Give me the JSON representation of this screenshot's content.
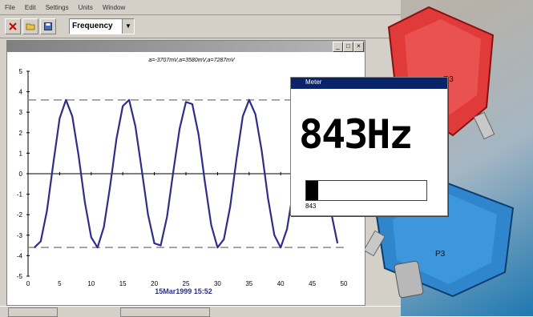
{
  "menu": {
    "items": [
      "File",
      "Edit",
      "Settings",
      "Units",
      "Window"
    ]
  },
  "toolbar": {
    "mode_value": "Frequency"
  },
  "scope": {
    "annotation": "a=-3707mV,a=3580mV,a=7287mV",
    "timestamp": "15Mar1999 15:52"
  },
  "meter": {
    "title": "Meter",
    "reading": "843Hz",
    "bar_level": 0.1,
    "sub_label": "843"
  },
  "devices": {
    "red_label": "R3",
    "blue_label": "P3"
  },
  "colors": {
    "trace": "#2e2d8c",
    "meter_title": "#0a246a",
    "red_device": "#e03a3a",
    "blue_device": "#2f86cc"
  },
  "icons": [
    "close-icon",
    "folder-icon",
    "save-icon",
    "maximize-icon",
    "restore-icon"
  ],
  "chart_data": {
    "type": "line",
    "x_ticks": [
      "0",
      "5",
      "10",
      "15",
      "20",
      "25",
      "30",
      "35",
      "40",
      "45",
      "50"
    ],
    "y_ticks": [
      "5",
      "4",
      "3",
      "2",
      "1",
      "0",
      "-1",
      "-2",
      "-3",
      "-4",
      "-5"
    ],
    "xlim": [
      0,
      50
    ],
    "ylim": [
      -5,
      5
    ],
    "series": [
      {
        "x": [
          1,
          2,
          3,
          4,
          5,
          6,
          7,
          8,
          9,
          10,
          11,
          12,
          13,
          14,
          15,
          16,
          17,
          18,
          19,
          20,
          21,
          22,
          23,
          24,
          25,
          26,
          27,
          28,
          29,
          30,
          31,
          32,
          33,
          34,
          35,
          36,
          37,
          38,
          39,
          40,
          41,
          42,
          43,
          44,
          45,
          46,
          47,
          48,
          49
        ],
        "y": [
          -3.6,
          -3.3,
          -1.8,
          0.5,
          2.7,
          3.6,
          2.8,
          0.9,
          -1.4,
          -3.1,
          -3.6,
          -2.6,
          -0.6,
          1.7,
          3.3,
          3.6,
          2.3,
          0.2,
          -2.0,
          -3.4,
          -3.5,
          -2.1,
          0.1,
          2.2,
          3.5,
          3.4,
          1.9,
          -0.4,
          -2.5,
          -3.6,
          -3.2,
          -1.6,
          0.7,
          2.8,
          3.6,
          2.9,
          1.1,
          -1.2,
          -3.0,
          -3.6,
          -2.7,
          -0.8,
          1.5,
          3.2,
          3.6,
          2.5,
          0.3,
          -1.9,
          -3.4
        ]
      }
    ],
    "reference_lines": [
      3.6,
      -3.6
    ],
    "grid": false
  }
}
